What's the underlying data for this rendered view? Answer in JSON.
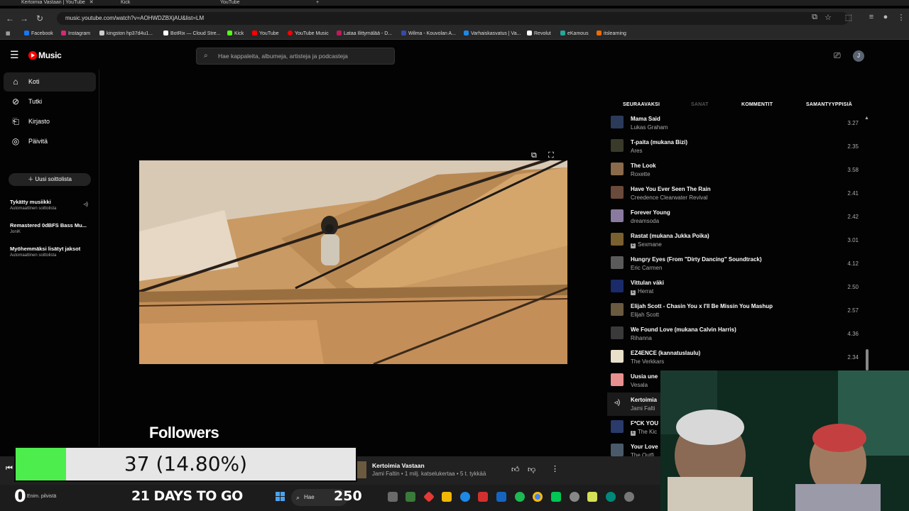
{
  "browser": {
    "tabs": [
      {
        "label": "Kertoimia Vastaan | YouTube"
      },
      {
        "label": "Kick"
      },
      {
        "label": "YouTube"
      }
    ],
    "url": "music.youtube.com/watch?v=AOHWDZBXjAU&list=LM",
    "bookmarks": [
      {
        "label": "Facebook",
        "color": "#1877f2"
      },
      {
        "label": "Instagram",
        "color": "#d62976"
      },
      {
        "label": "kingston hp37d4u1...",
        "color": "#cccccc"
      },
      {
        "label": "BotRix — Cloud Stre...",
        "color": "#ffffff"
      },
      {
        "label": "Kick",
        "color": "#53fc18"
      },
      {
        "label": "YouTube",
        "color": "#ff0000"
      },
      {
        "label": "YouTube Music",
        "color": "#ff0000"
      },
      {
        "label": "Lataa Ilittymälää - D...",
        "color": "#c2185b"
      },
      {
        "label": "Wilma - Kouvolan A...",
        "color": "#3949ab"
      },
      {
        "label": "Varhaiskasvatus | Va...",
        "color": "#1e88e5"
      },
      {
        "label": "Revolut",
        "color": "#ffffff"
      },
      {
        "label": "eKamous",
        "color": "#26a69a"
      },
      {
        "label": "itslearning",
        "color": "#ef6c00"
      }
    ]
  },
  "header": {
    "logo": "Music",
    "search_placeholder": "Hae kappaleita, albumeja, artisteja ja podcasteja",
    "avatar_initial": "J"
  },
  "sidebar": {
    "nav": [
      {
        "label": "Koti",
        "icon": "home-icon"
      },
      {
        "label": "Tutki",
        "icon": "explore-icon"
      },
      {
        "label": "Kirjasto",
        "icon": "library-icon"
      },
      {
        "label": "Päivitä",
        "icon": "upgrade-icon"
      }
    ],
    "new_playlist": "Uusi soittolista",
    "playlists": [
      {
        "title": "Tykätty musiikki",
        "subtitle": "Automaattinen soittolista"
      },
      {
        "title": "Remastered 0dBFS Bass Mu...",
        "subtitle": "JoniK"
      },
      {
        "title": "Myöhemmäksi lisätyt jaksot",
        "subtitle": "Automaattinen soittolista"
      }
    ]
  },
  "queue": {
    "tabs": [
      "SEURAAVAKSI",
      "SANAT",
      "KOMMENTIT",
      "SAMANTYYPPISIÄ"
    ],
    "items": [
      {
        "title": "Mama Said",
        "artist": "Lukas Graham",
        "duration": "3.27",
        "explicit": false,
        "thumb": "#2c3a5a"
      },
      {
        "title": "T-paita (mukana Bizi)",
        "artist": "Ares",
        "duration": "2.35",
        "explicit": false,
        "thumb": "#3a3a2a"
      },
      {
        "title": "The Look",
        "artist": "Roxette",
        "duration": "3.58",
        "explicit": false,
        "thumb": "#8a6a4a"
      },
      {
        "title": "Have You Ever Seen The Rain",
        "artist": "Creedence Clearwater Revival",
        "duration": "2.41",
        "explicit": false,
        "thumb": "#6a4a3a"
      },
      {
        "title": "Forever Young",
        "artist": "dreamsoda",
        "duration": "2.42",
        "explicit": false,
        "thumb": "#8a7aa0"
      },
      {
        "title": "Rastat (mukana Jukka Poika)",
        "artist": "Sexmane",
        "duration": "3.01",
        "explicit": true,
        "thumb": "#7a6030"
      },
      {
        "title": "Hungry Eyes (From \"Dirty Dancing\" Soundtrack)",
        "artist": "Eric Carmen",
        "duration": "4.12",
        "explicit": false,
        "thumb": "#5a5a5a"
      },
      {
        "title": "Vittulan väki",
        "artist": "Herrat",
        "duration": "2.50",
        "explicit": true,
        "thumb": "#1a2a6a"
      },
      {
        "title": "Elijah Scott - Chasin You x I'll Be Missin You Mashup",
        "artist": "Elijah Scott",
        "duration": "2.57",
        "explicit": false,
        "thumb": "#6a5a40"
      },
      {
        "title": "We Found Love (mukana Calvin Harris)",
        "artist": "Rihanna",
        "duration": "4.36",
        "explicit": false,
        "thumb": "#3a3a3a"
      },
      {
        "title": "EZ4ENCE (kannatuslaulu)",
        "artist": "The Verkkars",
        "duration": "2.34",
        "explicit": false,
        "thumb": "#e8e0c8"
      },
      {
        "title": "Uusia une",
        "artist": "Vesala",
        "duration": "",
        "explicit": false,
        "thumb": "#e89090"
      },
      {
        "title": "Kertoimia",
        "artist": "Jami Falti",
        "duration": "",
        "explicit": false,
        "thumb": "#222222",
        "playing": true
      },
      {
        "title": "F*CK YOU",
        "artist": "The Kic",
        "duration": "",
        "explicit": true,
        "thumb": "#2a3a6a"
      },
      {
        "title": "Your Love",
        "artist": "The Outfi",
        "duration": "",
        "explicit": false,
        "thumb": "#4a5a6a"
      }
    ]
  },
  "player": {
    "title": "Kertoimia Vastaan",
    "subtitle": "Jami Faltin • 1 milj. katselukertaa • 5 t. tykkää"
  },
  "overlay": {
    "followers_label": "Followers",
    "followers_text": "37 (14.80%)",
    "followers_fraction": 0.148,
    "days_to_go": "21 DAYS TO GO",
    "zero": "0",
    "count": "250",
    "weather": "Enim. pilvistä"
  },
  "taskbar": {
    "search_label": "Hae"
  }
}
